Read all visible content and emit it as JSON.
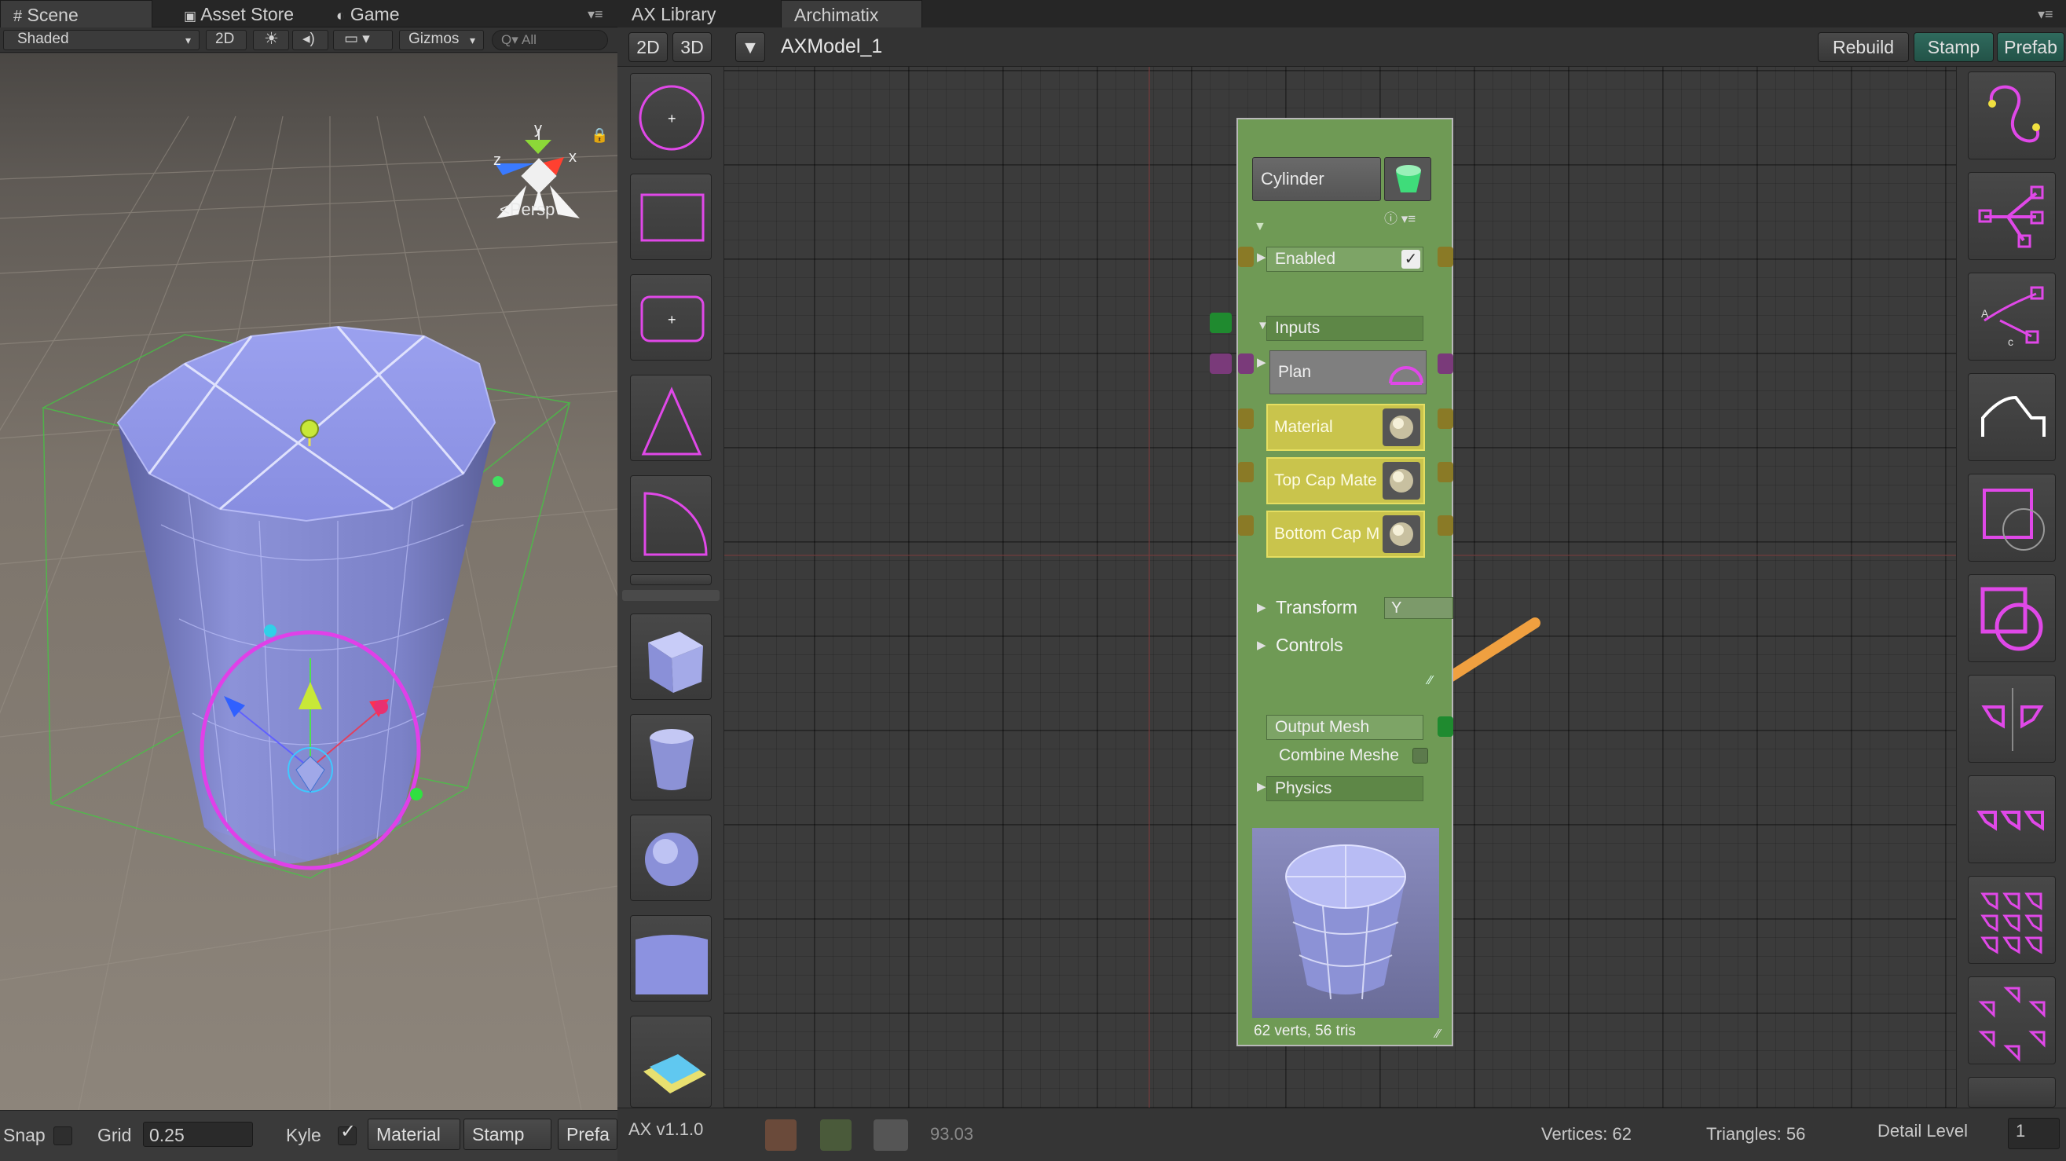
{
  "scene": {
    "tabs": [
      "Scene",
      "Asset Store",
      "Game"
    ],
    "toolbar": {
      "shading": "Shaded",
      "mode_2d": "2D",
      "gizmos": "Gizmos",
      "search_placeholder": "All"
    },
    "gizmo": {
      "y": "y",
      "x": "x",
      "z": "z",
      "persp": "<Persp"
    },
    "bottom": {
      "snap": "Snap",
      "grid": "Grid",
      "grid_value": "0.25",
      "kyle": "Kyle",
      "material": "Material",
      "stamp": "Stamp",
      "prefab": "Prefa"
    }
  },
  "ax": {
    "tabs": [
      "AX Library",
      "Archimatix"
    ],
    "toolbar": {
      "btn_2d": "2D",
      "btn_3d": "3D",
      "model_name": "AXModel_1",
      "rebuild": "Rebuild",
      "stamp": "Stamp",
      "prefab": "Prefab"
    },
    "node": {
      "title": "Cylinder",
      "enabled": "Enabled",
      "inputs": "Inputs",
      "plan": "Plan",
      "material": "Material",
      "top_cap": "Top Cap Mate",
      "bottom_cap": "Bottom Cap M",
      "transform": "Transform",
      "transform_axis": "Y",
      "controls": "Controls",
      "output_mesh": "Output Mesh",
      "combine_meshes": "Combine Meshe",
      "physics": "Physics",
      "stats": "62 verts, 56 tris"
    },
    "status": {
      "version": "AX v1.1.0",
      "zoom": "93.03",
      "vertices": "Vertices: 62",
      "triangles": "Triangles: 56",
      "detail_label": "Detail Level",
      "detail_value": "1"
    }
  },
  "colors": {
    "shape_magenta": "#e040e8",
    "node_green": "#6f9a55",
    "arrow_orange": "#f0a040",
    "accent_teal": "#2f6a5d"
  }
}
